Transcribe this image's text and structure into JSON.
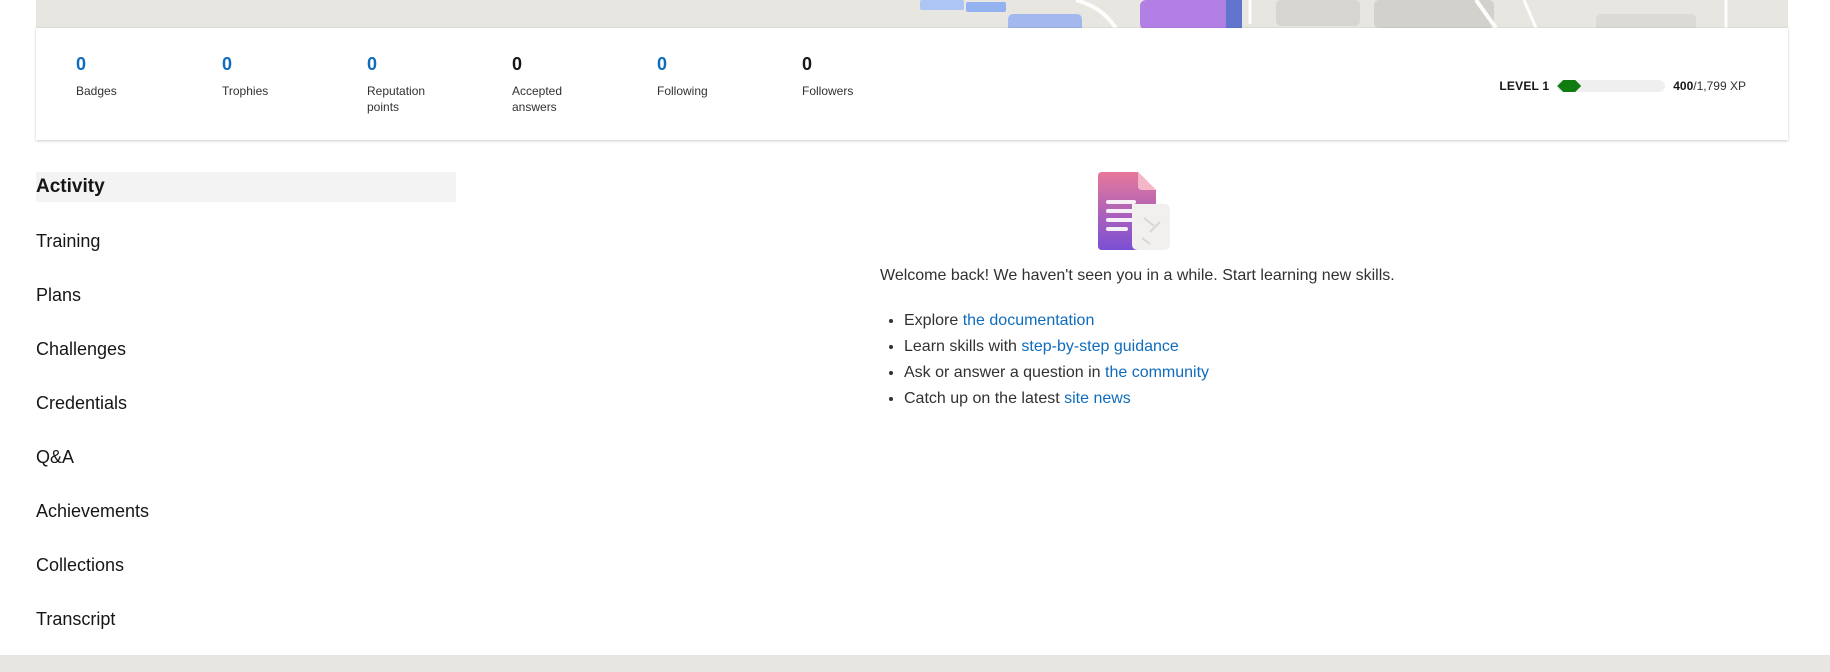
{
  "stats": [
    {
      "value": "0",
      "label": "Badges",
      "color": "#0f6cbd"
    },
    {
      "value": "0",
      "label": "Trophies",
      "color": "#0f6cbd"
    },
    {
      "value": "0",
      "label": "Reputation points",
      "color": "#0f6cbd"
    },
    {
      "value": "0",
      "label": "Accepted answers",
      "color": "#161616"
    },
    {
      "value": "0",
      "label": "Following",
      "color": "#0f6cbd"
    },
    {
      "value": "0",
      "label": "Followers",
      "color": "#161616"
    }
  ],
  "level": {
    "label": "LEVEL 1",
    "xp_current": "400",
    "xp_total": "/1,799 XP",
    "progress": 0.222,
    "bar_color": "#107c10"
  },
  "nav": {
    "items": [
      {
        "label": "Activity",
        "active": true
      },
      {
        "label": "Training",
        "active": false
      },
      {
        "label": "Plans",
        "active": false
      },
      {
        "label": "Challenges",
        "active": false
      },
      {
        "label": "Credentials",
        "active": false
      },
      {
        "label": "Q&A",
        "active": false
      },
      {
        "label": "Achievements",
        "active": false
      },
      {
        "label": "Collections",
        "active": false
      },
      {
        "label": "Transcript",
        "active": false
      }
    ]
  },
  "main": {
    "illustration_icon": "document-icon",
    "welcome": "Welcome back! We haven't seen you in a while. Start learning new skills.",
    "links": [
      {
        "prefix": "Explore ",
        "link": "the documentation"
      },
      {
        "prefix": "Learn skills with ",
        "link": "step-by-step guidance"
      },
      {
        "prefix": "Ask or answer a question in ",
        "link": "the community"
      },
      {
        "prefix": "Catch up on the latest ",
        "link": "site news"
      }
    ]
  },
  "colors": {
    "accent": "#0f6cbd",
    "banner_bg": "#e8e6e1"
  }
}
